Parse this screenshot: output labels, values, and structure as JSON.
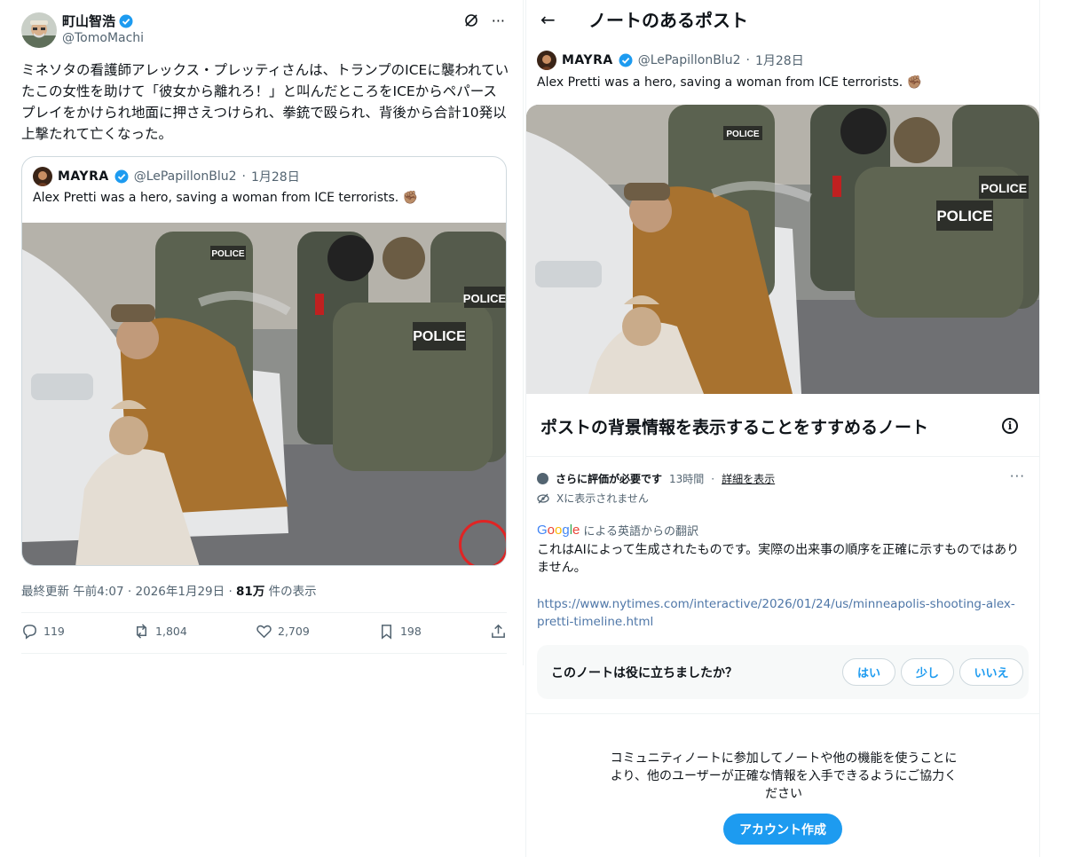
{
  "left_post": {
    "author_name": "町山智浩",
    "author_handle": "@TomoMachi",
    "text": "ミネソタの看護師アレックス・プレッティさんは、トランプのICEに襲われていたこの女性を助けて「彼女から離れろ！」と叫んだところをICEからペパースプレイをかけられ地面に押さえつけられ、拳銃で殴られ、背後から合計10発以上撃たれて亡くなった。",
    "quoted": {
      "name": "MAYRA",
      "handle": "@LePapillonBlu2",
      "date": "1月28日",
      "text": "Alex Pretti was a hero, saving a woman from ICE terrorists. ✊🏽",
      "image_desc": "police-scene-image"
    },
    "meta": {
      "updated_prefix": "最終更新",
      "time": "午前4:07",
      "date": "2026年1月29日",
      "views": "81万",
      "views_suffix": "件の表示"
    },
    "actions": {
      "replies": "119",
      "reposts": "1,804",
      "likes": "2,709",
      "bookmarks": "198"
    }
  },
  "right_panel": {
    "title": "ノートのあるポスト",
    "post": {
      "name": "MAYRA",
      "handle": "@LePapillonBlu2",
      "date": "1月28日",
      "text": "Alex Pretti was a hero, saving a woman from ICE terrorists. ✊🏽"
    },
    "note": {
      "heading": "ポストの背景情報を表示することをすすめるノート",
      "status": "さらに評価が必要です",
      "age": "13時間",
      "details_link": "詳細を表示",
      "not_shown": "Xに表示されません",
      "google_word": "Google",
      "translated_from": "による英語からの翻訳",
      "body": "これはAIによって生成されたものです。実際の出来事の順序を正確に示すものではありません。",
      "url": "https://www.nytimes.com/interactive/2026/01/24/us/minneapolis-shooting-alex-pretti-timeline.html"
    },
    "helpful": {
      "question": "このノートは役に立ちましたか？",
      "yes": "はい",
      "somewhat": "少し",
      "no": "いいえ"
    },
    "join": {
      "text": "コミュニティノートに参加してノートや他の機能を使うことにより、他のユーザーが正確な情報を入手できるようにご協力ください",
      "button": "アカウント作成"
    }
  },
  "colors": {
    "accent": "#1d9bf0",
    "muted": "#536471",
    "border": "#cfd9de",
    "highlight_circle": "#e02424"
  }
}
